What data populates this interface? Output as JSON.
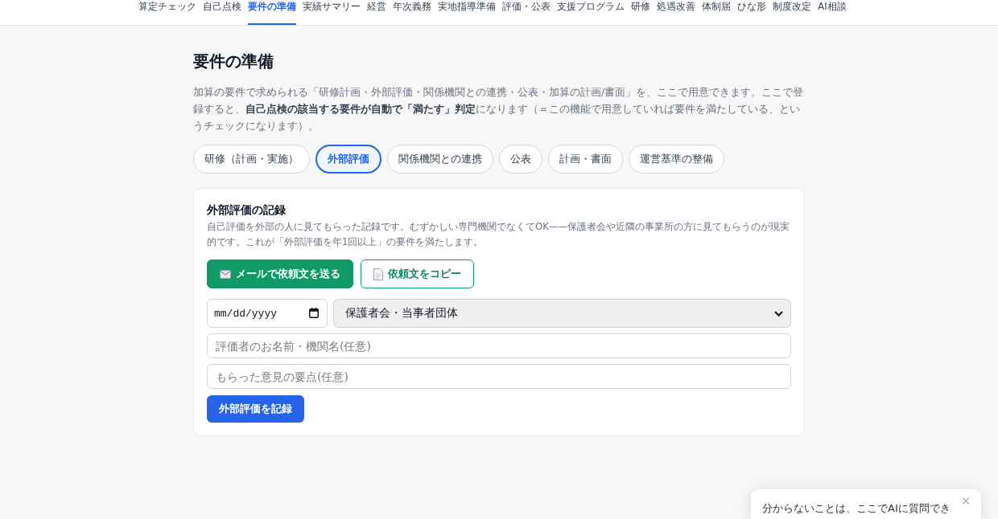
{
  "nav": [
    {
      "label": "算定チェック",
      "selected": false
    },
    {
      "label": "自己点検",
      "selected": false
    },
    {
      "label": "要件の準備",
      "selected": true
    },
    {
      "label": "実績サマリー",
      "selected": false
    },
    {
      "label": "経営",
      "selected": false
    },
    {
      "label": "年次義務",
      "selected": false
    },
    {
      "label": "実地指導準備",
      "selected": false
    },
    {
      "label": "評価・公表",
      "selected": false
    },
    {
      "label": "支援プログラム",
      "selected": false
    },
    {
      "label": "研修",
      "selected": false
    },
    {
      "label": "処遇改善",
      "selected": false
    },
    {
      "label": "体制届",
      "selected": false
    },
    {
      "label": "ひな形",
      "selected": false
    },
    {
      "label": "制度改定",
      "selected": false
    },
    {
      "label": "AI相談",
      "selected": false
    }
  ],
  "page": {
    "title": "要件の準備",
    "description": "加算の要件で求められる「研修計画・外部評価・関係機関との連携・公表・加算の計画/書面」を、ここで用意できます。ここで登録すると、**自己点検の該当する要件が自動で「満たす」判定**になります（＝この機能で用意していれば要件を満たしている、というチェックになります）。"
  },
  "tabs": [
    {
      "label": "研修（計画・実施）",
      "selected": false
    },
    {
      "label": "外部評価",
      "selected": true
    },
    {
      "label": "関係機関との連携",
      "selected": false
    },
    {
      "label": "公表",
      "selected": false
    },
    {
      "label": "計画・書面",
      "selected": false
    },
    {
      "label": "運営基準の整備",
      "selected": false
    }
  ],
  "card": {
    "title": "外部評価の記録",
    "description": "自己評価を外部の人に見てもらった記録です。むずかしい専門機関でなくてOK——保護者会や近隣の事業所の方に見てもらうのが現実的です。これが「外部評価を年1回以上」の要件を満たします。",
    "actions": [
      {
        "kind": "primary",
        "label": "メールで依頼文を送る"
      },
      {
        "kind": "outline",
        "label": "依頼文をコピー"
      }
    ],
    "date_field": {
      "placeholder": "mm/dd/yyyy"
    },
    "category_select": {
      "value": "保護者会・当事者団体"
    },
    "evaluator_field": {
      "placeholder": "評価者のお名前・機関名(任意)"
    },
    "feedback_field": {
      "placeholder": "もらった意見の要点(任意)"
    },
    "submit_button": "外部評価を記録"
  },
  "help_popup": {
    "text": "分からないことは、ここでAIに質問でき",
    "close": "×"
  }
}
